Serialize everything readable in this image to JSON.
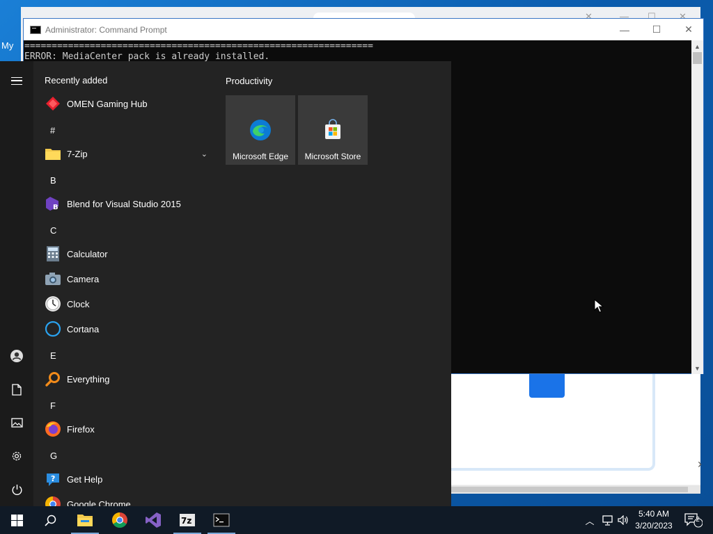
{
  "desktop": {
    "label": "My"
  },
  "cmd": {
    "title": "Administrator:  Command Prompt",
    "lines": [
      "================================================================",
      "ERROR: MediaCenter pack is already installed."
    ]
  },
  "start": {
    "recently_added": "Recently added",
    "apps": [
      {
        "kind": "app",
        "label": "OMEN Gaming Hub",
        "icon": "omen-icon"
      },
      {
        "kind": "letter",
        "label": "#"
      },
      {
        "kind": "app",
        "label": "7-Zip",
        "icon": "folder-icon",
        "expandable": true
      },
      {
        "kind": "letter",
        "label": "B"
      },
      {
        "kind": "app",
        "label": "Blend for Visual Studio 2015",
        "icon": "blend-icon"
      },
      {
        "kind": "letter",
        "label": "C"
      },
      {
        "kind": "app",
        "label": "Calculator",
        "icon": "calculator-icon"
      },
      {
        "kind": "app",
        "label": "Camera",
        "icon": "camera-icon"
      },
      {
        "kind": "app",
        "label": "Clock",
        "icon": "clock-icon"
      },
      {
        "kind": "app",
        "label": "Cortana",
        "icon": "cortana-icon"
      },
      {
        "kind": "letter",
        "label": "E"
      },
      {
        "kind": "app",
        "label": "Everything",
        "icon": "everything-icon"
      },
      {
        "kind": "letter",
        "label": "F"
      },
      {
        "kind": "app",
        "label": "Firefox",
        "icon": "firefox-icon"
      },
      {
        "kind": "letter",
        "label": "G"
      },
      {
        "kind": "app",
        "label": "Get Help",
        "icon": "get-help-icon"
      },
      {
        "kind": "app",
        "label": "Google Chrome",
        "icon": "chrome-icon"
      }
    ],
    "tiles_group": "Productivity",
    "tiles": [
      {
        "label": "Microsoft Edge",
        "icon": "edge-icon"
      },
      {
        "label": "Microsoft Store",
        "icon": "store-icon"
      }
    ]
  },
  "taskbar": {
    "apps": [
      "start-icon",
      "search-icon",
      "file-explorer-icon",
      "chrome-icon",
      "visual-studio-icon",
      "7zip-icon",
      "terminal-icon"
    ],
    "clock_time": "5:40 AM",
    "clock_date": "3/20/2023",
    "notification_count": "2"
  },
  "colors": {
    "start_bg": "#232323",
    "rail_bg": "#1b1b1b",
    "tile_bg": "#3a3a3a",
    "taskbar_bg": "#101a26",
    "cmd_bg": "#0c0c0c"
  }
}
